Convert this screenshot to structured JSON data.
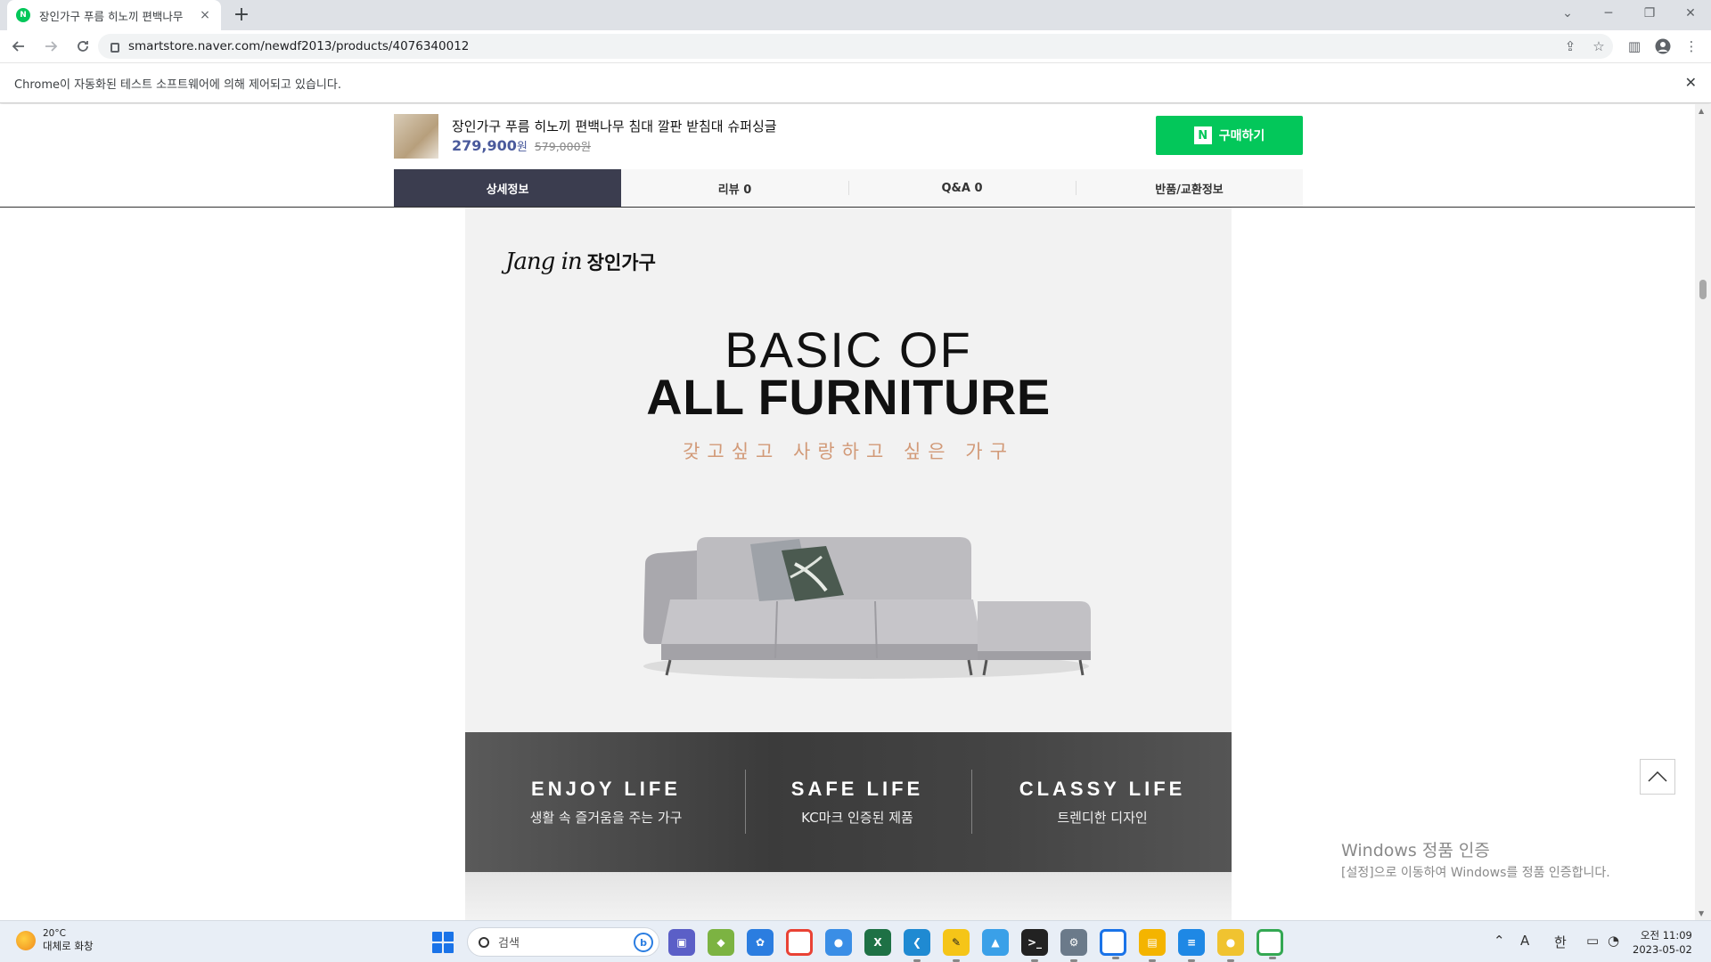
{
  "browser": {
    "tab_title": "장인가구 푸름 히노끼 편백나무",
    "tab_close": "×",
    "new_tab": "+",
    "url": "smartstore.naver.com/newdf2013/products/4076340012",
    "window_controls": {
      "minimize": "─",
      "restore": "❐",
      "close": "✕",
      "tab_search": "⌄"
    }
  },
  "infobar": {
    "message": "Chrome이 자동화된 테스트 소프트웨어에 의해 제어되고 있습니다.",
    "close": "✕"
  },
  "product": {
    "name": "장인가구 푸름 히노끼 편백나무 침대 깔판 받침대 슈퍼싱글",
    "price": "279,900",
    "price_unit": "원",
    "original_price": "579,000원",
    "buy_button": "구매하기",
    "buy_logo": "N"
  },
  "product_tabs": [
    {
      "label": "상세정보",
      "active": true
    },
    {
      "label": "리뷰 0",
      "active": false
    },
    {
      "label": "Q&A 0",
      "active": false
    },
    {
      "label": "반품/교환정보",
      "active": false
    }
  ],
  "detail": {
    "brand_script": "Jang in",
    "brand_korean": "장인가구",
    "headline_thin": "BASIC OF",
    "headline_bold": "ALL FURNITURE",
    "tagline": "갖고싶고 사랑하고 싶은 가구",
    "features": [
      {
        "title": "ENJOY LIFE",
        "subtitle": "생활 속 즐거움을 주는 가구"
      },
      {
        "title": "SAFE LIFE",
        "subtitle": "KC마크 인증된 제품"
      },
      {
        "title": "CLASSY LIFE",
        "subtitle": "트렌디한 디자인"
      }
    ]
  },
  "watermark": {
    "line1": "Windows 정품 인증",
    "line2": "[설정]으로 이동하여 Windows를 정품 인증합니다."
  },
  "taskbar": {
    "weather_temp": "20°C",
    "weather_desc": "대체로 화창",
    "search_placeholder": "검색",
    "bing_label": "b",
    "ime_a": "A",
    "ime_han": "한",
    "time": "오전 11:09",
    "date": "2023-05-02"
  },
  "colors": {
    "naver_green": "#03c75a",
    "active_tab": "#3b3d4f",
    "price_blue": "#4a5a9c",
    "tagline_orange": "#d29a78"
  }
}
